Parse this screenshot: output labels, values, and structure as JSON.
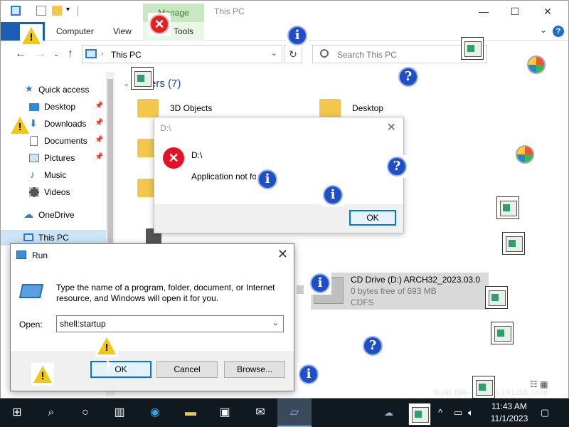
{
  "explorer": {
    "manage_tab": "Manage",
    "window_title": "This PC",
    "ribbon_tabs": [
      "Computer",
      "View",
      "Tools"
    ],
    "address": "This PC",
    "search_placeholder": "Search This PC",
    "nav_items": [
      {
        "label": "Quick access"
      },
      {
        "label": "Desktop"
      },
      {
        "label": "Downloads"
      },
      {
        "label": "Documents"
      },
      {
        "label": "Pictures"
      },
      {
        "label": "Music"
      },
      {
        "label": "Videos"
      },
      {
        "label": "OneDrive"
      },
      {
        "label": "This PC"
      }
    ],
    "folders_header": "ers (7)",
    "folders": [
      "3D Objects",
      "Desktop"
    ],
    "cd_drive": {
      "name": "CD Drive (D:) ARCH32_2023.03.0",
      "free": "0 bytes free of 693 MB",
      "fs": "CDFS"
    }
  },
  "error_dialog": {
    "title": "D:\\",
    "path": "D:\\",
    "message": "Application not fo",
    "ok_label": "OK"
  },
  "run_dialog": {
    "title": "Run",
    "description": "Type the name of a program, folder, document, or Internet resource, and Windows will open it for you.",
    "open_label": "Open:",
    "input_value": "shell:startup",
    "ok_label": "OK",
    "cancel_label": "Cancel",
    "browse_label": "Browse..."
  },
  "watermark": "Build 190—  elease.191206-1406",
  "taskbar": {
    "time": "11:43 AM",
    "date": "11/1/2023"
  },
  "colors": {
    "accent": "#0078d7",
    "taskbar": "#101820",
    "manage_tab": "#c9e7c3",
    "error_red": "#e81123"
  }
}
